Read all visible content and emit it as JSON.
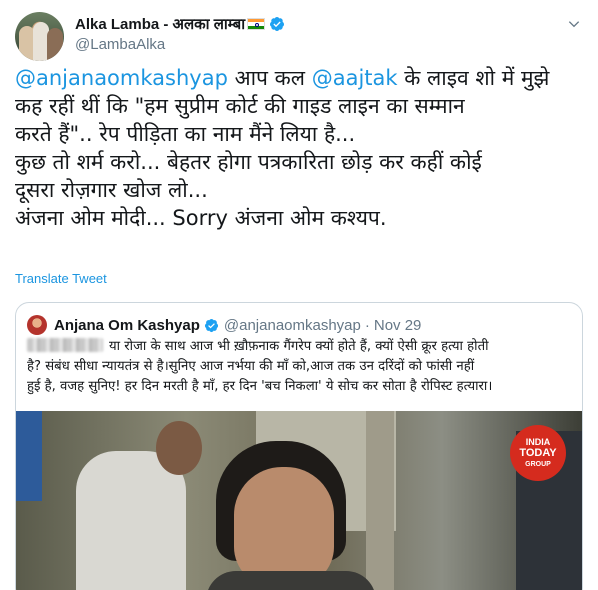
{
  "tweet": {
    "display_name": "Alka Lamba - अलका लाम्बा",
    "handle": "@LambaAlka",
    "text_lines": [
      [
        "@anjanaomkashyap",
        " आप कल ",
        "@aajtak",
        " के लाइव शो में मुझे"
      ],
      "कह रहीं थीं कि \"हम सुप्रीम कोर्ट की गाइड लाइन का सम्मान",
      "करते हैं\"..  रेप पीड़िता का नाम मैंने लिया है...",
      "कुछ तो शर्म करो... बेहतर होगा पत्रकारिता छोड़ कर कहीं कोई",
      "दूसरा रोज़गार खोज लो...",
      "अंजना ओम मोदी... Sorry अंजना ओम कश्यप."
    ],
    "translate_label": "Translate Tweet"
  },
  "quoted": {
    "display_name": "Anjana Om Kashyap",
    "handle": "@anjanaomkashyap",
    "separator": "·",
    "date": "Nov 29",
    "text_lines": [
      "या रोजा के साथ आज भी ख़ौफ़नाक गैंगरेप क्यों होते हैं, क्यों ऐसी क्रूर हत्या होती",
      "है? संबंध सीधा न्यायतंत्र से है।सुनिए आज नर्भया की माँ को,आज तक उन दरिंदों को फांसी नहीं",
      "हुई है, वजह सुनिए! हर दिन मरती है माँ, हर दिन 'बच निकला' ये सोच कर सोता है रोपिस्ट हत्यारा।"
    ],
    "media_logo": [
      "INDIA",
      "TODAY",
      "GROUP"
    ]
  },
  "colors": {
    "link": "#1b95e0",
    "verified": "#1da1f2",
    "secondary_text": "#657786",
    "border": "#ccd6dd"
  },
  "icons": {
    "verified": "verified-badge-icon",
    "chevron": "chevron-down-icon",
    "flag": "india-flag-emoji"
  }
}
